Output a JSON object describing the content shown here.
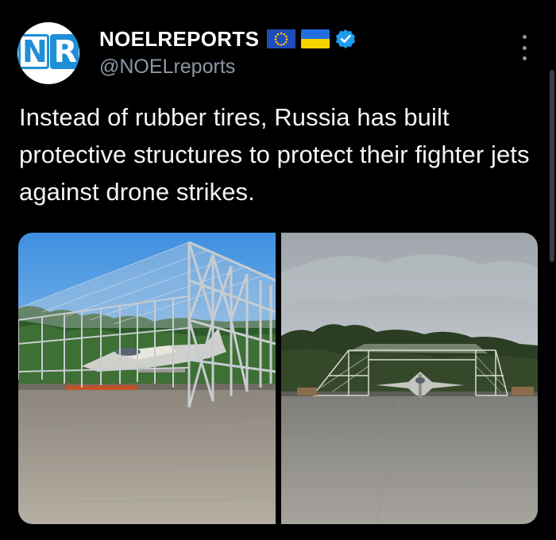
{
  "author": {
    "avatar_text_left": "N",
    "avatar_text_right": "R",
    "display_name": "NOELREPORTS",
    "handle": "@NOELreports",
    "badges": [
      "eu-flag-icon",
      "ukraine-flag-icon",
      "verified-icon"
    ]
  },
  "tweet": {
    "text": "Instead of rubber tires, Russia has built protective structures to protect their fighter jets against drone strikes."
  },
  "media": [
    {
      "name": "photo-left",
      "description_icon": "image"
    },
    {
      "name": "photo-right",
      "description_icon": "image"
    }
  ],
  "colors": {
    "background": "#000000",
    "text": "#e7e9ea",
    "secondary": "#8b98a5",
    "verified": "#1d9bf0",
    "avatar_accent": "#1d8fd6"
  }
}
